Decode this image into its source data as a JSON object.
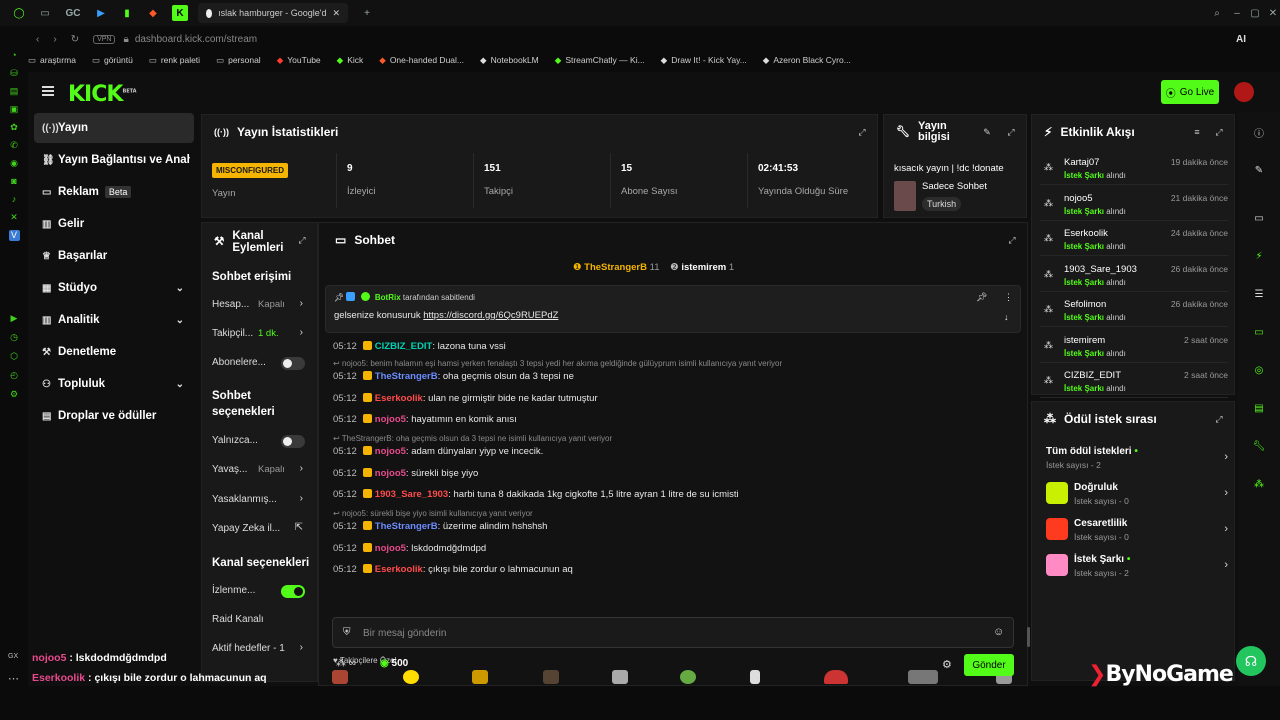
{
  "browser": {
    "gx_label": "GC",
    "tab_title": "ıslak hamburger - Google'd",
    "vpn": "VPN",
    "url": "dashboard.kick.com/stream",
    "ai_label": "AI",
    "bookmarks": [
      "araştırma",
      "görüntü",
      "renk paleti",
      "personal",
      "YouTube",
      "Kick",
      "One-handed Dual...",
      "NotebookLM",
      "StreamChatly — Ki...",
      "Draw It! - Kick Yay...",
      "Azeron Black Cyro..."
    ]
  },
  "app": {
    "logo": "KICK",
    "logo_beta": "BETA",
    "go_live": "Go Live"
  },
  "nav": {
    "items": [
      {
        "label": "Yayın"
      },
      {
        "label": "Yayın Bağlantısı ve Anahtar"
      },
      {
        "label": "Reklam",
        "badge": "Beta"
      },
      {
        "label": "Gelir"
      },
      {
        "label": "Başarılar"
      },
      {
        "label": "Stüdyo"
      },
      {
        "label": "Analitik"
      },
      {
        "label": "Denetleme"
      },
      {
        "label": "Topluluk"
      },
      {
        "label": "Droplar ve ödüller"
      }
    ]
  },
  "stats": {
    "title": "Yayın İstatistikleri",
    "status_badge": "MISCONFIGURED",
    "status_label": "Yayın",
    "items": [
      {
        "value": "9",
        "label": "İzleyici"
      },
      {
        "value": "151",
        "label": "Takipçi"
      },
      {
        "value": "15",
        "label": "Abone Sayısı"
      },
      {
        "value": "02:41:53",
        "label": "Yayında Olduğu Süre"
      }
    ]
  },
  "info": {
    "title": "Yayın bilgisi",
    "stream_title": "kısacık yayın | !dc !donate",
    "category": "Sadece Sohbet",
    "language": "Turkish"
  },
  "events": {
    "title": "Etkinlik Akışı",
    "items": [
      {
        "name": "Kartaj07",
        "time": "19 dakika önce",
        "type": "İstek Şarkı",
        "suffix": "alındı"
      },
      {
        "name": "nojoo5",
        "time": "21 dakika önce",
        "type": "İstek Şarkı",
        "suffix": "alındı"
      },
      {
        "name": "Eserkoolik",
        "time": "24 dakika önce",
        "type": "İstek Şarkı",
        "suffix": "alındı"
      },
      {
        "name": "1903_Sare_1903",
        "time": "26 dakika önce",
        "type": "İstek Şarkı",
        "suffix": "alındı"
      },
      {
        "name": "Sefolimon",
        "time": "26 dakika önce",
        "type": "İstek Şarkı",
        "suffix": "alındı"
      },
      {
        "name": "istemirem",
        "time": "2 saat önce",
        "type": "İstek Şarkı",
        "suffix": "alındı"
      },
      {
        "name": "CIZBIZ_EDIT",
        "time": "2 saat önce",
        "type": "İstek Şarkı",
        "suffix": "alındı"
      }
    ]
  },
  "rewards": {
    "title": "Ödül istek sırası",
    "all_label": "Tüm ödül istekleri",
    "all_count": "İstek sayısı - 2",
    "items": [
      {
        "name": "Doğruluk",
        "count": "İstek sayısı - 0",
        "color": "#c8f000"
      },
      {
        "name": "Cesaretlilik",
        "count": "İstek sayısı - 0",
        "color": "#ff3b1f"
      },
      {
        "name": "İstek Şarkı",
        "count": "İstek sayısı - 2",
        "color": "#ff8ac4"
      }
    ]
  },
  "actions": {
    "title": "Kanal Eylemleri",
    "chat_access": "Sohbet erişimi",
    "rows1": [
      {
        "label": "Hesap...",
        "value": "Kapalı"
      },
      {
        "label": "Takipçil...",
        "value": "1 dk."
      },
      {
        "label": "Abonelere..."
      }
    ],
    "chat_options": "Sohbet seçenekleri",
    "rows2": [
      {
        "label": "Yalnızca..."
      },
      {
        "label": "Yavaş...",
        "value": "Kapalı"
      },
      {
        "label": "Yasaklanmış..."
      },
      {
        "label": "Yapay Zeka il..."
      }
    ],
    "channel_options": "Kanal seçenekleri",
    "rows3": [
      {
        "label": "İzlenme..."
      },
      {
        "label": "Raid Kanalı"
      },
      {
        "label": "Aktif hedefler - 1"
      }
    ]
  },
  "chat": {
    "title": "Sohbet",
    "top_users": [
      {
        "name": "TheStrangerB",
        "count": "11"
      },
      {
        "name": "istemirem",
        "count": "1"
      }
    ],
    "pinned_by": "BotRix",
    "pinned_suffix": "tarafından sabitlendi",
    "pinned_text": "gelsenize konusuruk",
    "pinned_link": "https://discord.gg/6Qc9RUEPdZ",
    "messages": [
      {
        "time": "05:12",
        "user": "CIZBIZ_EDIT",
        "text": "lazona tuna vssi",
        "cls": "u-teal"
      },
      {
        "reply": "nojoo5: benim halamın eşi hamsi yerken fenalaştı 3 tepsi yedi her akıma geldiğinde gülüyprum isimli kullanıcıya yanıt veriyor"
      },
      {
        "time": "05:12",
        "user": "TheStrangerB",
        "text": "oha geçmis olsun da 3 tepsi ne",
        "cls": "u-blue"
      },
      {
        "time": "05:12",
        "user": "Eserkoolik",
        "text": "ulan ne girmiştir bide ne kadar tutmuştur",
        "cls": "u-red"
      },
      {
        "time": "05:12",
        "user": "nojoo5",
        "text": "hayatımın en komik anısı",
        "cls": "u-pink"
      },
      {
        "reply": "TheStrangerB: oha geçmis olsun da 3 tepsi ne isimli kullanıcıya yanıt veriyor"
      },
      {
        "time": "05:12",
        "user": "nojoo5",
        "text": "adam dünyaları yiyp ve incecik.",
        "cls": "u-pink"
      },
      {
        "time": "05:12",
        "user": "nojoo5",
        "text": "sürekli bişe yiyo",
        "cls": "u-pink"
      },
      {
        "time": "05:12",
        "user": "1903_Sare_1903",
        "text": "harbi tuna 8 dakikada 1kg cigkofte 1,5 litre ayran 1 litre de su icmisti",
        "cls": "u-red"
      },
      {
        "reply": "nojoo5: sürekli bişe yiyo isimli kullanıcıya yanıt veriyor"
      },
      {
        "time": "05:12",
        "user": "TheStrangerB",
        "text": "üzerime alindim hshshsh",
        "cls": "u-blue"
      },
      {
        "time": "05:12",
        "user": "nojoo5",
        "text": "lskdodmdğdmdpd",
        "cls": "u-pink"
      },
      {
        "time": "05:12",
        "user": "Eserkoolik",
        "text": "çıkışı bile zordur o lahmacunun aq",
        "cls": "u-red"
      }
    ],
    "followers_only": "Takipçilere Özel",
    "input_placeholder": "Bir mesaj gönderin",
    "points": "500",
    "send": "Gönder"
  },
  "overlay": {
    "lines": [
      {
        "user": "nojoo5",
        "text": "lskdodmdğdmdpd"
      },
      {
        "user": "Eserkoolik",
        "text": "çıkışı bile zordur o lahmacunun aq"
      }
    ],
    "brand": "ByNoGame",
    "gx": "GX"
  }
}
